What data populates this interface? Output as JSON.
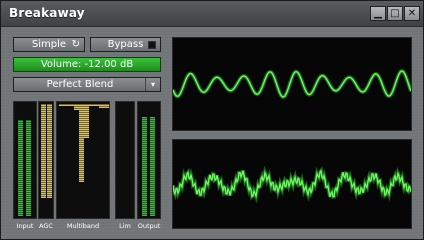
{
  "window": {
    "title": "Breakaway"
  },
  "titlebar_buttons": [
    {
      "name": "minimize-icon",
      "glyph": "▁"
    },
    {
      "name": "maximize-icon",
      "glyph": "□"
    },
    {
      "name": "close-icon",
      "glyph": "✕"
    }
  ],
  "controls": {
    "mode_label": "Simple",
    "mode_icon": "↻",
    "bypass_label": "Bypass",
    "volume_text": "Volume: -12.00 dB",
    "preset_label": "Perfect Blend",
    "preset_arrow": "▾"
  },
  "meters": {
    "labels": {
      "input": "Input",
      "agc": "AGC",
      "multiband": "Multiband",
      "lim": "Lim",
      "output": "Output"
    },
    "input_levels": [
      0.86,
      0.86
    ],
    "agc_levels": [
      0.84,
      0.84
    ],
    "multiband_levels": [
      0.02,
      0.02,
      0.02,
      0.05,
      0.7,
      0.3,
      0.02,
      0.02,
      0.04,
      0.04
    ],
    "lim_levels": [
      0.0,
      0.0
    ],
    "output_levels": [
      0.88,
      0.88
    ],
    "colors": {
      "green": "#2fc22f",
      "yellow": "#e9c23a"
    }
  }
}
